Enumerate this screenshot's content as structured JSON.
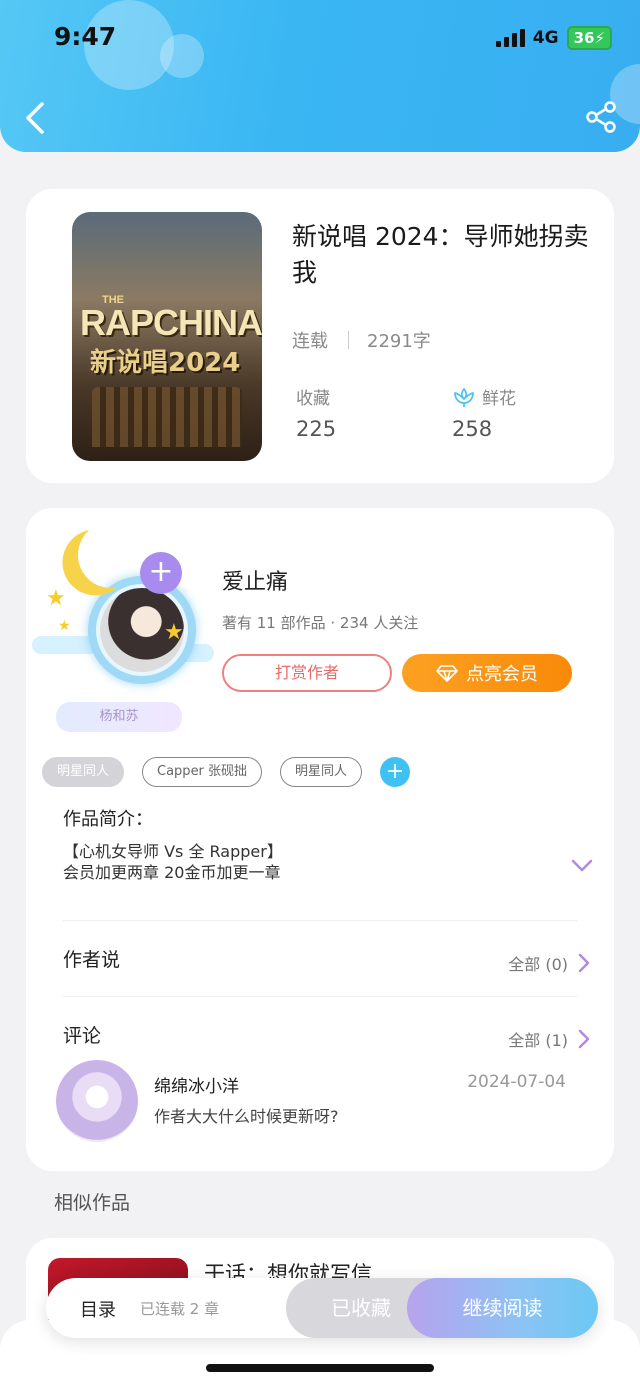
{
  "status_bar": {
    "time": "9:47",
    "network": "4G",
    "battery": "36"
  },
  "header": {
    "back_icon": "chevron-left-icon",
    "share_icon": "share-icon"
  },
  "book": {
    "title": "新说唱 2024：导师她拐卖我",
    "status": "连载",
    "word_count": "2291字",
    "cover_text": {
      "the": "THE",
      "rap": "RAPCHINA",
      "cn": "新说唱2024"
    },
    "favorites_label": "收藏",
    "favorites_value": "225",
    "flowers_label": "鲜花",
    "flowers_value": "258"
  },
  "author": {
    "name": "爱止痛",
    "info": "著有 11 部作品 · 234 人关注",
    "pen_badge": "杨和苏",
    "tip_label": "打赏作者",
    "vip_label": "点亮会员"
  },
  "tags": [
    "明星同人",
    "Capper 张砚拙",
    "明星同人"
  ],
  "intro": {
    "title": "作品简介：",
    "line1": "【心机女导师 Vs 全 Rapper】",
    "line2": "会员加更两章 20金币加更一章"
  },
  "author_says": {
    "title": "作者说",
    "all": "全部 (0)"
  },
  "comments": {
    "title": "评论",
    "all": "全部 (1)",
    "items": [
      {
        "user": "绵绵冰小洋",
        "date": "2024-07-04",
        "text": "作者大大什么时候更新呀?"
      }
    ]
  },
  "similar": {
    "title": "相似作品",
    "first_book": "干话：想你就写信"
  },
  "bottom_bar": {
    "toc": "目录",
    "chapters": "已连载 2 章",
    "collected": "已收藏",
    "continue": "继续阅读"
  },
  "colors": {
    "brand": "#3ab6f3",
    "vip": "#fca123",
    "tip": "#e96a6a",
    "accent_purple": "#a98bf0"
  }
}
